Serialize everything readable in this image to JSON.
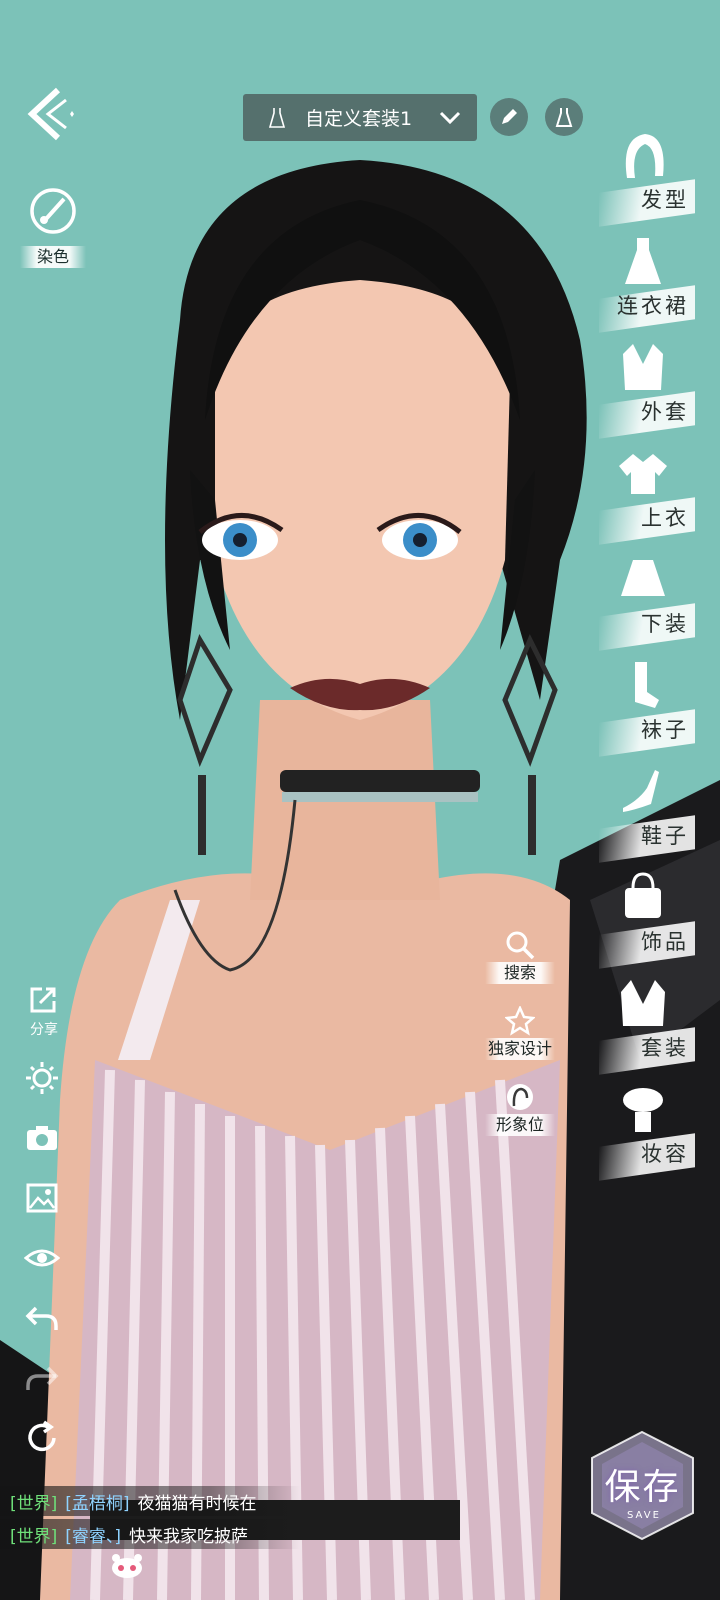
{
  "top_bar": {
    "outfit_name": "自定义套装1"
  },
  "left_tools": {
    "dye_label": "染色",
    "share_label": "分享"
  },
  "categories": [
    {
      "label": "发型",
      "icon": "hair-icon"
    },
    {
      "label": "连衣裙",
      "icon": "dress-icon"
    },
    {
      "label": "外套",
      "icon": "coat-icon"
    },
    {
      "label": "上衣",
      "icon": "top-icon"
    },
    {
      "label": "下装",
      "icon": "skirt-icon"
    },
    {
      "label": "袜子",
      "icon": "socks-icon"
    },
    {
      "label": "鞋子",
      "icon": "shoe-icon"
    },
    {
      "label": "饰品",
      "icon": "bag-icon"
    },
    {
      "label": "套装",
      "icon": "suit-icon"
    },
    {
      "label": "妆容",
      "icon": "makeup-icon"
    }
  ],
  "middle_tools": {
    "search": "搜索",
    "exclusive": "独家设计",
    "image_slot": "形象位"
  },
  "save": {
    "label": "保存",
    "sub": "SAVE"
  },
  "chat": [
    {
      "channel": "[世界]",
      "name": "[孟梧桐]",
      "message": "夜猫猫有时候在"
    },
    {
      "channel": "[世界]",
      "name": "[睿睿、]",
      "message": "快来我家吃披萨"
    }
  ]
}
